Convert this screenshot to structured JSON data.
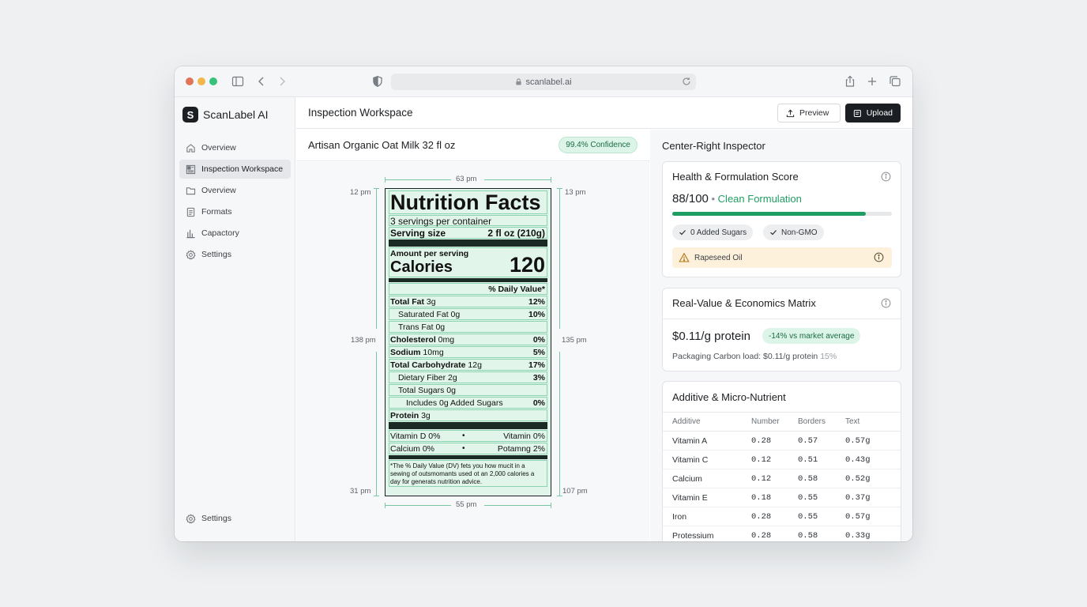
{
  "browser": {
    "url": "scanlabel.ai"
  },
  "app": {
    "name": "ScanLabel AI",
    "logo_letter": "S"
  },
  "sidebar": {
    "items": [
      {
        "label": "Overview",
        "icon": "home-icon"
      },
      {
        "label": "Inspection Workspace",
        "icon": "grid-icon",
        "active": true
      },
      {
        "label": "Overview",
        "icon": "folder-icon"
      },
      {
        "label": "Formats",
        "icon": "document-icon"
      },
      {
        "label": "Capactory",
        "icon": "bar-chart-icon"
      },
      {
        "label": "Settings",
        "icon": "gear-icon"
      }
    ],
    "bottom_item": {
      "label": "Settings",
      "icon": "gear-icon"
    }
  },
  "header": {
    "title": "Inspection Workspace",
    "preview_label": "Preview",
    "upload_label": "Upload"
  },
  "workspace": {
    "product_title": "Artisan Organic Oat Milk 32 fl oz",
    "confidence": "99.4% Confidence",
    "dimensions": {
      "top": "63 pm",
      "bottom": "55 pm",
      "left_top": "12 pm",
      "left_mid": "138 pm",
      "left_bottom": "31 pm",
      "right_top": "13 pm",
      "right_mid": "135 pm",
      "right_bottom": "107 pm"
    }
  },
  "nutrition": {
    "title": "Nutrition Facts",
    "servings": "3 servings per container",
    "serving_size_label": "Serving size",
    "serving_size_value": "2 fl oz (210g)",
    "amount_per_serving": "Amount per serving",
    "calories_label": "Calories",
    "calories_value": "120",
    "daily_value_header": "% Daily Value*",
    "rows": [
      {
        "label_bold": "Total Fat",
        "label": " 3g",
        "dv": "12%",
        "indent": 0
      },
      {
        "label_bold": "",
        "label": "Saturated Fat 0g",
        "dv": "10%",
        "indent": 1
      },
      {
        "label_bold": "",
        "label": "Trans Fat 0g",
        "dv": "",
        "indent": 1
      },
      {
        "label_bold": "Cholesterol",
        "label": " 0mg",
        "dv": "0%",
        "indent": 0
      },
      {
        "label_bold": "Sodium",
        "label": " 10mg",
        "dv": "5%",
        "indent": 0
      },
      {
        "label_bold": "Total Carbohydrate",
        "label": " 12g",
        "dv": "17%",
        "indent": 0
      },
      {
        "label_bold": "",
        "label": "Dietary Fiber 2g",
        "dv": "3%",
        "indent": 1
      },
      {
        "label_bold": "",
        "label": "Total Sugars 0g",
        "dv": "",
        "indent": 1
      },
      {
        "label_bold": "",
        "label": "Includes 0g Added Sugars",
        "dv": "0%",
        "indent": 2
      },
      {
        "label_bold": "Protein",
        "label": " 3g",
        "dv": "",
        "indent": 0
      }
    ],
    "vitamin_row_1_left": "Vitamin D 0%",
    "vitamin_row_1_right": "Vitamin 0%",
    "vitamin_row_2_left": "Calcium 0%",
    "vitamin_row_2_right": "Potamng 2%",
    "bullet": "•",
    "footnote": "*The % Daily Value (DV) fets you how mucit in a sewing of outsmomants used ot an 2,000 calories a day for generats nutrition advice."
  },
  "inspector": {
    "title": "Center-Right Inspector",
    "health": {
      "title": "Health & Formulation Score",
      "score": "88/100",
      "separator": " • ",
      "tag": "Clean Formulation",
      "progress_fraction": 0.88,
      "chips": [
        "0 Added Sugars",
        "Non-GMO"
      ],
      "warning": "Rapeseed Oil"
    },
    "economics": {
      "title": "Real-Value & Economics Matrix",
      "price": "$0.11/g protein",
      "badge": "-14% vs market average",
      "carbon_label": "Packaging Carbon load: $0.11/g protein",
      "carbon_pct": "15%"
    },
    "additives": {
      "title": "Additive & Micro-Nutrient",
      "columns": [
        "Additive",
        "Number",
        "Borders",
        "Text"
      ],
      "rows": [
        [
          "Vitamin A",
          "0.28",
          "0.57",
          "0.57g"
        ],
        [
          "Vitamin C",
          "0.12",
          "0.51",
          "0.43g"
        ],
        [
          "Calcium",
          "0.12",
          "0.58",
          "0.52g"
        ],
        [
          "Vitamin E",
          "0.18",
          "0.55",
          "0.37g"
        ],
        [
          "Iron",
          "0.28",
          "0.55",
          "0.57g"
        ],
        [
          "Protessium",
          "0.28",
          "0.58",
          "0.33g"
        ]
      ]
    }
  },
  "colors": {
    "accent_green": "#1f9e63",
    "label_fill": "#e1f5ea",
    "warning_bg": "#fdf1dc",
    "primary_button": "#1b1e22"
  }
}
